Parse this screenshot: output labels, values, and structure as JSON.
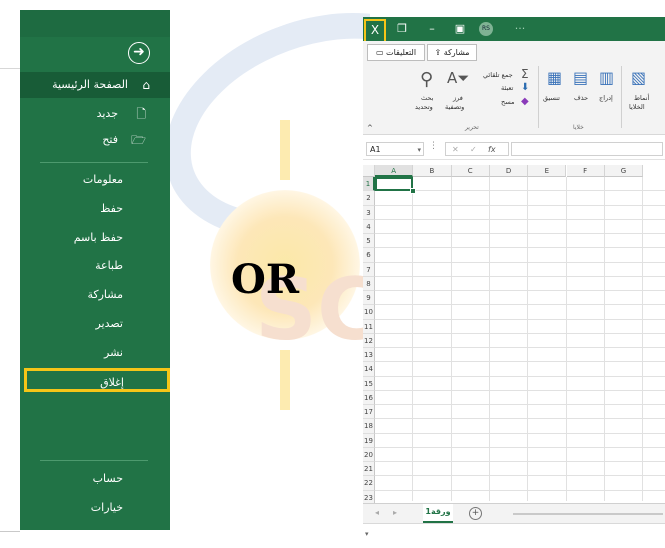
{
  "backstage": {
    "back_icon": "back-arrow-icon",
    "home": "الصفحة الرئيسية",
    "new": "جديد",
    "open": "فتح",
    "info": "معلومات",
    "save": "حفظ",
    "save_as": "حفظ باسم",
    "print": "طباعة",
    "share": "مشاركة",
    "export": "تصدير",
    "publish": "نشر",
    "close": "إغلاق",
    "account": "حساب",
    "options": "خيارات"
  },
  "separator_text": "OR",
  "excel": {
    "title_bar": {
      "close_glyph": "X",
      "avatar": "RS"
    },
    "tabs_bar": {
      "comments": "التعليقات",
      "share": "مشاركة"
    },
    "ribbon": {
      "autosum": "جمع تلقائي",
      "fill": "تعبئة",
      "clear": "مسح",
      "sort_filter_1": "فرز",
      "sort_filter_2": "وتصفية",
      "find_select_1": "بحث",
      "find_select_2": "وتحديد",
      "editing_group": "تحرير",
      "format": "تنسيق",
      "delete": "حذف",
      "insert": "إدراج",
      "cells_group": "خلايا",
      "styles_1": "أنماط",
      "styles_2": "الخلايا"
    },
    "formula_bar": {
      "name_box": "A1",
      "fx": "fx"
    },
    "grid": {
      "columns": [
        "A",
        "B",
        "C",
        "D",
        "E",
        "F",
        "G"
      ],
      "rows": [
        "1",
        "2",
        "3",
        "4",
        "5",
        "6",
        "7",
        "8",
        "9",
        "10",
        "11",
        "12",
        "13",
        "14",
        "15",
        "16",
        "17",
        "18",
        "19",
        "20",
        "21",
        "22",
        "23"
      ]
    },
    "sheet_tab": "ورقة1"
  }
}
